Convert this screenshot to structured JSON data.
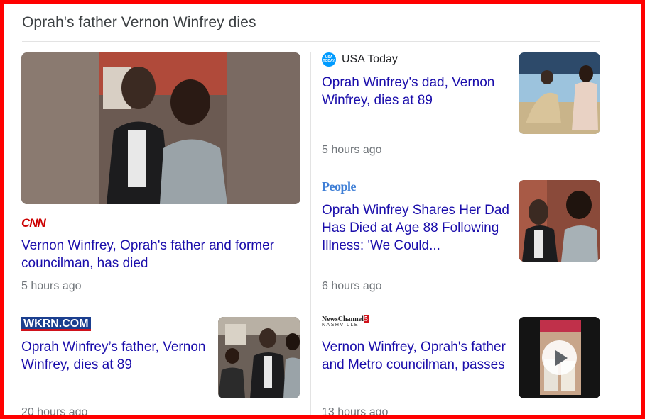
{
  "section_title": "Oprah's father Vernon Winfrey dies",
  "colors": {
    "link": "#1a0dab",
    "meta": "#70757a",
    "frame": "#ff0000"
  },
  "articles": [
    {
      "source": "CNN",
      "source_logo": "cnn-logo",
      "title": "Vernon Winfrey, Oprah's father and former councilman, has died",
      "time": "5 hours ago"
    },
    {
      "source": "USA Today",
      "source_logo": "usa-today-logo",
      "logo_text": "USA TODAY",
      "title": "Oprah Winfrey's dad, Vernon Winfrey, dies at 89",
      "time": "5 hours ago"
    },
    {
      "source": "People",
      "source_logo": "people-logo",
      "title": "Oprah Winfrey Shares Her Dad Has Died at Age 88 Following Illness: 'We Could...",
      "time": "6 hours ago"
    },
    {
      "source": "WKRN.COM",
      "source_logo": "wkrn-logo",
      "title": "Oprah Winfrey’s father, Vernon Winfrey, dies at 89",
      "time": "20 hours ago"
    },
    {
      "source": "NewsChannel 5 Nashville",
      "source_logo": "newschannel5-logo",
      "logo_line1": "NewsChannel",
      "logo_number": "5",
      "logo_line2": "NASHVILLE",
      "title": "Vernon Winfrey, Oprah's father and Metro councilman, passes",
      "time": "13 hours ago"
    }
  ]
}
